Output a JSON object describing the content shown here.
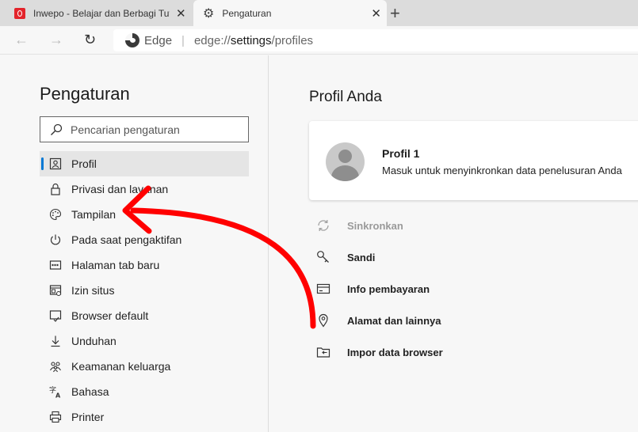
{
  "tabs": [
    {
      "title": "Inwepo - Belajar dan Berbagi Tut",
      "icon": "opera-icon"
    },
    {
      "title": "Pengaturan",
      "icon": "gear-icon"
    }
  ],
  "address": {
    "browser_name": "Edge",
    "url_prefix": "edge://",
    "url_host": "settings",
    "url_path": "/profiles"
  },
  "sidebar": {
    "title": "Pengaturan",
    "search_placeholder": "Pencarian pengaturan",
    "items": [
      {
        "label": "Profil",
        "icon": "profile-icon",
        "active": true
      },
      {
        "label": "Privasi dan layanan",
        "icon": "lock-icon"
      },
      {
        "label": "Tampilan",
        "icon": "palette-icon"
      },
      {
        "label": "Pada saat pengaktifan",
        "icon": "power-icon"
      },
      {
        "label": "Halaman tab baru",
        "icon": "newtab-icon"
      },
      {
        "label": "Izin situs",
        "icon": "site-permissions-icon"
      },
      {
        "label": "Browser default",
        "icon": "default-browser-icon"
      },
      {
        "label": "Unduhan",
        "icon": "download-icon"
      },
      {
        "label": "Keamanan keluarga",
        "icon": "family-icon"
      },
      {
        "label": "Bahasa",
        "icon": "language-icon"
      },
      {
        "label": "Printer",
        "icon": "printer-icon"
      }
    ]
  },
  "main": {
    "title": "Profil Anda",
    "profile": {
      "name": "Profil 1",
      "description": "Masuk untuk menyinkronkan data penelusuran Anda"
    },
    "rows": [
      {
        "label": "Sinkronkan",
        "icon": "sync-icon",
        "disabled": true
      },
      {
        "label": "Sandi",
        "icon": "key-icon"
      },
      {
        "label": "Info pembayaran",
        "icon": "card-icon"
      },
      {
        "label": "Alamat dan lainnya",
        "icon": "location-icon"
      },
      {
        "label": "Impor data browser",
        "icon": "import-icon"
      }
    ]
  },
  "colors": {
    "accent": "#0078d4",
    "annotation_arrow": "#ff0000"
  }
}
